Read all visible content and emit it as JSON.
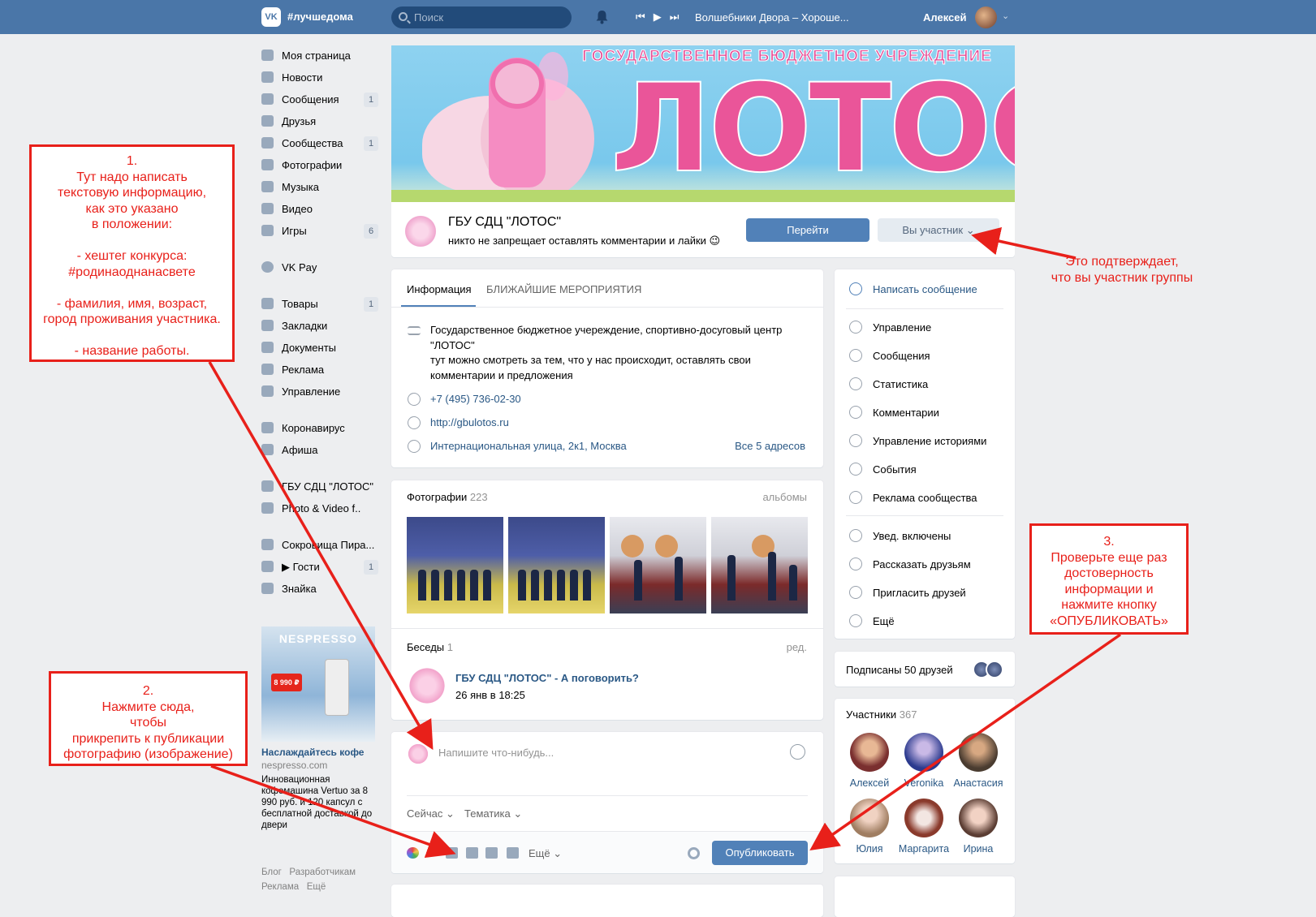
{
  "topbar": {
    "logo": "VK",
    "hashtag": "#лучшедома",
    "search_placeholder": "Поиск",
    "track": "Волшебники Двора – Хороше...",
    "user_name": "Алексей"
  },
  "menu": {
    "items": [
      {
        "label": "Моя страница",
        "icon": "user-home-icon",
        "badge": ""
      },
      {
        "label": "Новости",
        "icon": "news-icon",
        "badge": ""
      },
      {
        "label": "Сообщения",
        "icon": "messages-icon",
        "badge": "1"
      },
      {
        "label": "Друзья",
        "icon": "friends-icon",
        "badge": ""
      },
      {
        "label": "Сообщества",
        "icon": "communities-icon",
        "badge": "1"
      },
      {
        "label": "Фотографии",
        "icon": "camera-icon",
        "badge": ""
      },
      {
        "label": "Музыка",
        "icon": "music-icon",
        "badge": ""
      },
      {
        "label": "Видео",
        "icon": "video-icon",
        "badge": ""
      },
      {
        "label": "Игры",
        "icon": "games-icon",
        "badge": "6"
      }
    ],
    "items2": [
      {
        "label": "VK Pay",
        "icon": "vkpay-icon",
        "badge": ""
      }
    ],
    "items3": [
      {
        "label": "Товары",
        "icon": "bag-icon",
        "badge": "1"
      },
      {
        "label": "Закладки",
        "icon": "star-icon",
        "badge": ""
      },
      {
        "label": "Документы",
        "icon": "document-icon",
        "badge": ""
      },
      {
        "label": "Реклама",
        "icon": "megaphone-icon",
        "badge": ""
      },
      {
        "label": "Управление",
        "icon": "gamepad-icon",
        "badge": ""
      }
    ],
    "items4": [
      {
        "label": "Коронавирус",
        "icon": "virus-icon",
        "badge": ""
      },
      {
        "label": "Афиша",
        "icon": "poster-icon",
        "badge": ""
      }
    ],
    "items5": [
      {
        "label": "ГБУ СДЦ \"ЛОТОС\"",
        "icon": "group-icon",
        "badge": ""
      },
      {
        "label": "Photo & Video f..",
        "icon": "group-icon",
        "badge": ""
      }
    ],
    "items6": [
      {
        "label": "Сокровища Пира...",
        "icon": "flask-icon",
        "badge": ""
      },
      {
        "label": "▶ Гости",
        "icon": "app-grid-icon",
        "badge": "1"
      },
      {
        "label": "Знайка",
        "icon": "app-grid-icon",
        "badge": ""
      }
    ]
  },
  "ad": {
    "brand": "NESPRESSO",
    "price": "8 990 ₽",
    "title": "Наслаждайтесь кофе",
    "domain": "nespresso.com",
    "text": "Инновационная кофемашина Vertuo за 8 990 руб. и 120 капсул с бесплатной доставкой до двери"
  },
  "footer": {
    "links": "Блог   Разработчикам",
    "links2": "Реклама   Ещё"
  },
  "cover": {
    "top_text": "ГОСУДАРСТВЕННОЕ БЮДЖЕТНОЕ УЧРЕЖДЕНИЕ",
    "big_text": "ЛОТОС"
  },
  "group": {
    "name": "ГБУ СДЦ \"ЛОТОС\"",
    "status": "никто не запрещает оставлять комментарии и лайки 😉",
    "go_button": "Перейти",
    "member_button": "Вы участник ⌄"
  },
  "info": {
    "tab_info": "Информация",
    "tab_events": "БЛИЖАЙШИЕ МЕРОПРИЯТИЯ",
    "description": "Государственное бюджетное учереждение, спортивно-досуговый центр \"ЛОТОС\"\nтут можно смотреть за тем, что у нас происходит, оставлять свои комментарии и предложения",
    "phone": "+7 (495) 736-02-30",
    "site": "http://gbulotos.ru",
    "address": "Интернациональная улица, 2к1, Москва",
    "all_addresses": "Все 5 адресов"
  },
  "photos": {
    "title": "Фотографии",
    "count": "223",
    "albums": "альбомы"
  },
  "chats": {
    "title": "Беседы",
    "count": "1",
    "edit": "ред.",
    "chat_title": "ГБУ СДЦ \"ЛОТОС\" - А поговорить?",
    "chat_date": "26 янв в 18:25"
  },
  "post": {
    "placeholder": "Напишите что-нибудь...",
    "time": "Сейчас ⌄",
    "topic": "Тематика ⌄",
    "more": "Ещё ⌄",
    "publish": "Опубликовать"
  },
  "actions": {
    "primary": "Написать сообщение",
    "group1": [
      "Управление",
      "Сообщения",
      "Статистика",
      "Комментарии",
      "Управление историями",
      "События",
      "Реклама сообщества"
    ],
    "group2": [
      "Увед. включены",
      "Рассказать друзьям",
      "Пригласить друзей",
      "Ещё"
    ]
  },
  "friends": {
    "text": "Подписаны 50 друзей"
  },
  "members": {
    "title": "Участники",
    "count": "367",
    "list": [
      "Алексей",
      "Veronika",
      "Анастасия",
      "Юлия",
      "Маргарита",
      "Ирина"
    ]
  },
  "annotations": {
    "box1": "1.\nТут надо написать\nтекстовую информацию,\nкак это указано\nв положении:\n\n- хештег конкурса:\n#родинаоднанасвете\n\n- фамилия, имя, возраст,\nгород проживания участника.\n\n- название работы.",
    "box2": "2.\nНажмите сюда,\nчтобы\nприкрепить к публикации\nфотографию (изображение)",
    "box3": "3.\nПроверьте еще раз\nдостоверность\nинформации и\nнажмите кнопку\n«ОПУБЛИКОВАТЬ»",
    "member_note": "Это подтверждает,\nчто вы участник группы"
  },
  "colors": {
    "header": "#4a76a8",
    "accent": "#5181b8",
    "link": "#2a5885",
    "annotation": "#e8201a"
  }
}
